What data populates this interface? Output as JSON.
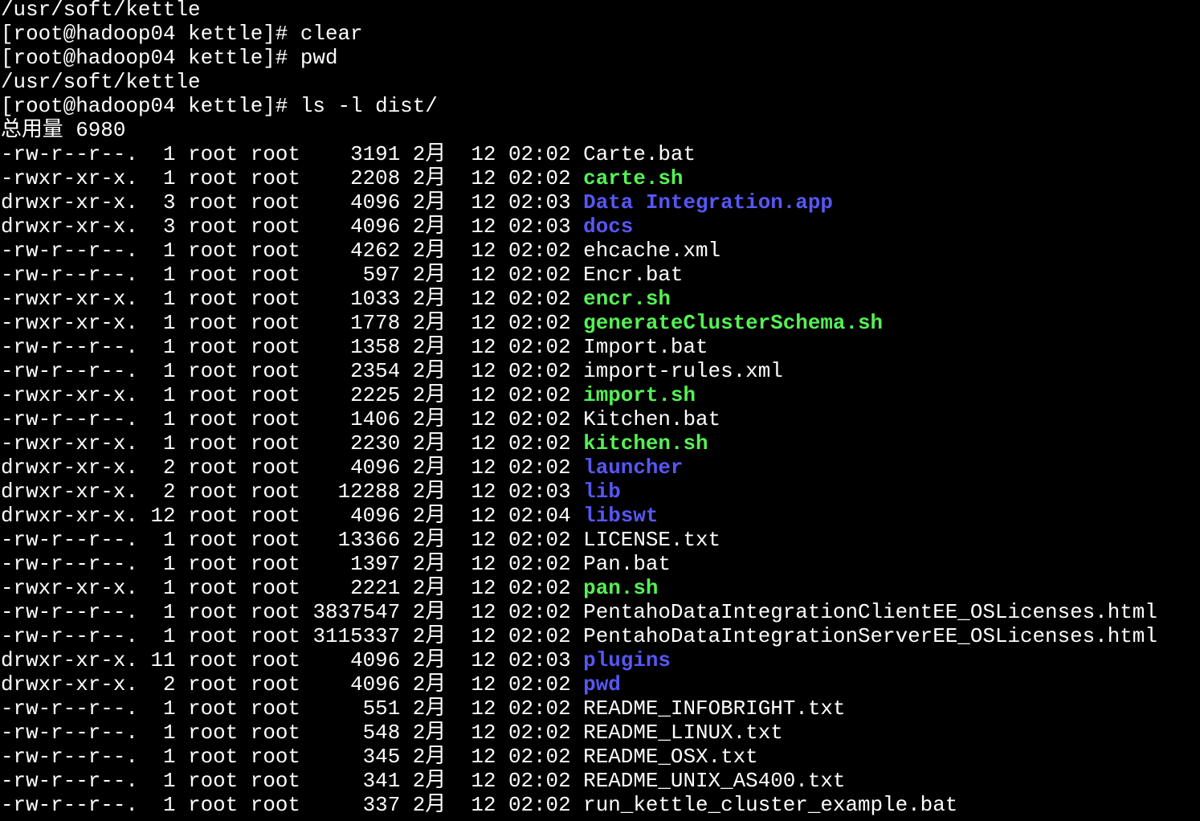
{
  "terminal": {
    "header_lines": [
      "/usr/soft/kettle",
      "[root@hadoop04 kettle]# clear",
      "[root@hadoop04 kettle]# pwd",
      "/usr/soft/kettle",
      "[root@hadoop04 kettle]# ls -l dist/",
      "总用量 6980"
    ],
    "colors": {
      "background": "#000000",
      "text": "#ffffff",
      "executable": "#55f155",
      "directory": "#5757f5"
    },
    "entries": [
      {
        "perm": "-rw-r--r--.",
        "links": "1",
        "owner": "root",
        "group": "root",
        "size": "3191",
        "month": "2月",
        "day": "12",
        "time": "02:02",
        "name": "Carte.bat",
        "type": "file"
      },
      {
        "perm": "-rwxr-xr-x.",
        "links": "1",
        "owner": "root",
        "group": "root",
        "size": "2208",
        "month": "2月",
        "day": "12",
        "time": "02:02",
        "name": "carte.sh",
        "type": "exec"
      },
      {
        "perm": "drwxr-xr-x.",
        "links": "3",
        "owner": "root",
        "group": "root",
        "size": "4096",
        "month": "2月",
        "day": "12",
        "time": "02:03",
        "name": "Data Integration.app",
        "type": "dir"
      },
      {
        "perm": "drwxr-xr-x.",
        "links": "3",
        "owner": "root",
        "group": "root",
        "size": "4096",
        "month": "2月",
        "day": "12",
        "time": "02:03",
        "name": "docs",
        "type": "dir"
      },
      {
        "perm": "-rw-r--r--.",
        "links": "1",
        "owner": "root",
        "group": "root",
        "size": "4262",
        "month": "2月",
        "day": "12",
        "time": "02:02",
        "name": "ehcache.xml",
        "type": "file"
      },
      {
        "perm": "-rw-r--r--.",
        "links": "1",
        "owner": "root",
        "group": "root",
        "size": "597",
        "month": "2月",
        "day": "12",
        "time": "02:02",
        "name": "Encr.bat",
        "type": "file"
      },
      {
        "perm": "-rwxr-xr-x.",
        "links": "1",
        "owner": "root",
        "group": "root",
        "size": "1033",
        "month": "2月",
        "day": "12",
        "time": "02:02",
        "name": "encr.sh",
        "type": "exec"
      },
      {
        "perm": "-rwxr-xr-x.",
        "links": "1",
        "owner": "root",
        "group": "root",
        "size": "1778",
        "month": "2月",
        "day": "12",
        "time": "02:02",
        "name": "generateClusterSchema.sh",
        "type": "exec"
      },
      {
        "perm": "-rw-r--r--.",
        "links": "1",
        "owner": "root",
        "group": "root",
        "size": "1358",
        "month": "2月",
        "day": "12",
        "time": "02:02",
        "name": "Import.bat",
        "type": "file"
      },
      {
        "perm": "-rw-r--r--.",
        "links": "1",
        "owner": "root",
        "group": "root",
        "size": "2354",
        "month": "2月",
        "day": "12",
        "time": "02:02",
        "name": "import-rules.xml",
        "type": "file"
      },
      {
        "perm": "-rwxr-xr-x.",
        "links": "1",
        "owner": "root",
        "group": "root",
        "size": "2225",
        "month": "2月",
        "day": "12",
        "time": "02:02",
        "name": "import.sh",
        "type": "exec"
      },
      {
        "perm": "-rw-r--r--.",
        "links": "1",
        "owner": "root",
        "group": "root",
        "size": "1406",
        "month": "2月",
        "day": "12",
        "time": "02:02",
        "name": "Kitchen.bat",
        "type": "file"
      },
      {
        "perm": "-rwxr-xr-x.",
        "links": "1",
        "owner": "root",
        "group": "root",
        "size": "2230",
        "month": "2月",
        "day": "12",
        "time": "02:02",
        "name": "kitchen.sh",
        "type": "exec"
      },
      {
        "perm": "drwxr-xr-x.",
        "links": "2",
        "owner": "root",
        "group": "root",
        "size": "4096",
        "month": "2月",
        "day": "12",
        "time": "02:02",
        "name": "launcher",
        "type": "dir"
      },
      {
        "perm": "drwxr-xr-x.",
        "links": "2",
        "owner": "root",
        "group": "root",
        "size": "12288",
        "month": "2月",
        "day": "12",
        "time": "02:03",
        "name": "lib",
        "type": "dir"
      },
      {
        "perm": "drwxr-xr-x.",
        "links": "12",
        "owner": "root",
        "group": "root",
        "size": "4096",
        "month": "2月",
        "day": "12",
        "time": "02:04",
        "name": "libswt",
        "type": "dir"
      },
      {
        "perm": "-rw-r--r--.",
        "links": "1",
        "owner": "root",
        "group": "root",
        "size": "13366",
        "month": "2月",
        "day": "12",
        "time": "02:02",
        "name": "LICENSE.txt",
        "type": "file"
      },
      {
        "perm": "-rw-r--r--.",
        "links": "1",
        "owner": "root",
        "group": "root",
        "size": "1397",
        "month": "2月",
        "day": "12",
        "time": "02:02",
        "name": "Pan.bat",
        "type": "file"
      },
      {
        "perm": "-rwxr-xr-x.",
        "links": "1",
        "owner": "root",
        "group": "root",
        "size": "2221",
        "month": "2月",
        "day": "12",
        "time": "02:02",
        "name": "pan.sh",
        "type": "exec"
      },
      {
        "perm": "-rw-r--r--.",
        "links": "1",
        "owner": "root",
        "group": "root",
        "size": "3837547",
        "month": "2月",
        "day": "12",
        "time": "02:02",
        "name": "PentahoDataIntegrationClientEE_OSLicenses.html",
        "type": "file"
      },
      {
        "perm": "-rw-r--r--.",
        "links": "1",
        "owner": "root",
        "group": "root",
        "size": "3115337",
        "month": "2月",
        "day": "12",
        "time": "02:02",
        "name": "PentahoDataIntegrationServerEE_OSLicenses.html",
        "type": "file"
      },
      {
        "perm": "drwxr-xr-x.",
        "links": "11",
        "owner": "root",
        "group": "root",
        "size": "4096",
        "month": "2月",
        "day": "12",
        "time": "02:03",
        "name": "plugins",
        "type": "dir"
      },
      {
        "perm": "drwxr-xr-x.",
        "links": "2",
        "owner": "root",
        "group": "root",
        "size": "4096",
        "month": "2月",
        "day": "12",
        "time": "02:02",
        "name": "pwd",
        "type": "dir"
      },
      {
        "perm": "-rw-r--r--.",
        "links": "1",
        "owner": "root",
        "group": "root",
        "size": "551",
        "month": "2月",
        "day": "12",
        "time": "02:02",
        "name": "README_INFOBRIGHT.txt",
        "type": "file"
      },
      {
        "perm": "-rw-r--r--.",
        "links": "1",
        "owner": "root",
        "group": "root",
        "size": "548",
        "month": "2月",
        "day": "12",
        "time": "02:02",
        "name": "README_LINUX.txt",
        "type": "file"
      },
      {
        "perm": "-rw-r--r--.",
        "links": "1",
        "owner": "root",
        "group": "root",
        "size": "345",
        "month": "2月",
        "day": "12",
        "time": "02:02",
        "name": "README_OSX.txt",
        "type": "file"
      },
      {
        "perm": "-rw-r--r--.",
        "links": "1",
        "owner": "root",
        "group": "root",
        "size": "341",
        "month": "2月",
        "day": "12",
        "time": "02:02",
        "name": "README_UNIX_AS400.txt",
        "type": "file"
      },
      {
        "perm": "-rw-r--r--.",
        "links": "1",
        "owner": "root",
        "group": "root",
        "size": "337",
        "month": "2月",
        "day": "12",
        "time": "02:02",
        "name": "run_kettle_cluster_example.bat",
        "type": "file"
      }
    ]
  }
}
